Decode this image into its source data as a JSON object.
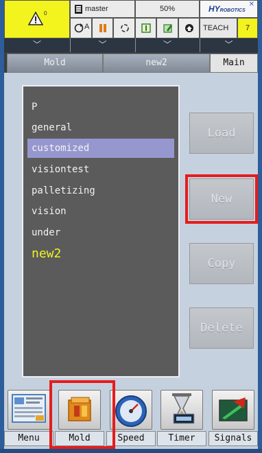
{
  "status": {
    "alarm_count": "0",
    "user": "master",
    "speed": "50%",
    "brand": "HY",
    "brand_suffix": "ROBOTICS",
    "mode": "TEACH",
    "mode_value": "7",
    "auto_label": "A"
  },
  "tabs": [
    "Mold",
    "new2",
    "Main"
  ],
  "molds": {
    "items": [
      "P",
      "general",
      "customized",
      "visiontest",
      "palletizing",
      "vision",
      "under"
    ],
    "selected": "customized",
    "current": "new2"
  },
  "actions": {
    "load": "Load",
    "new": "New",
    "copy": "Copy",
    "delete": "Delete"
  },
  "nav": [
    "Menu",
    "Mold",
    "Speed",
    "Timer",
    "Signals"
  ],
  "colors": {
    "alarm_bg": "#f3f31e",
    "highlight": "#e61c1c",
    "selected_row": "#9797d0",
    "current_mold_text": "#f2f21e"
  },
  "icons": [
    "warning-icon",
    "user-icon",
    "auto-mode-icon",
    "pause-icon",
    "cycle-icon",
    "io-icon",
    "edit-icon",
    "home-icon",
    "close-icon"
  ]
}
